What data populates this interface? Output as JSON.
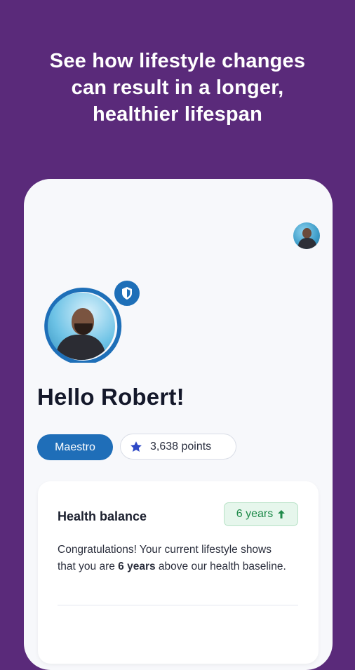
{
  "headline": {
    "line1": "See how lifestyle changes",
    "line2": "can result in a longer,",
    "line3": "healthier lifespan"
  },
  "profile": {
    "greeting": "Hello Robert!",
    "tier": "Maestro",
    "points": "3,638 points"
  },
  "health_balance": {
    "title": "Health balance",
    "badge": "6 years",
    "badge_icon": "arrow-up-icon",
    "text_before": "Congratulations! Your current lifestyle shows that you are ",
    "text_bold": "6 years",
    "text_after": " above our health baseline."
  },
  "colors": {
    "background": "#5a2a7a",
    "accent": "#1f6eb8",
    "positive": "#1f8a4a"
  },
  "icons": {
    "shield": "shield-icon",
    "star": "star-icon"
  }
}
